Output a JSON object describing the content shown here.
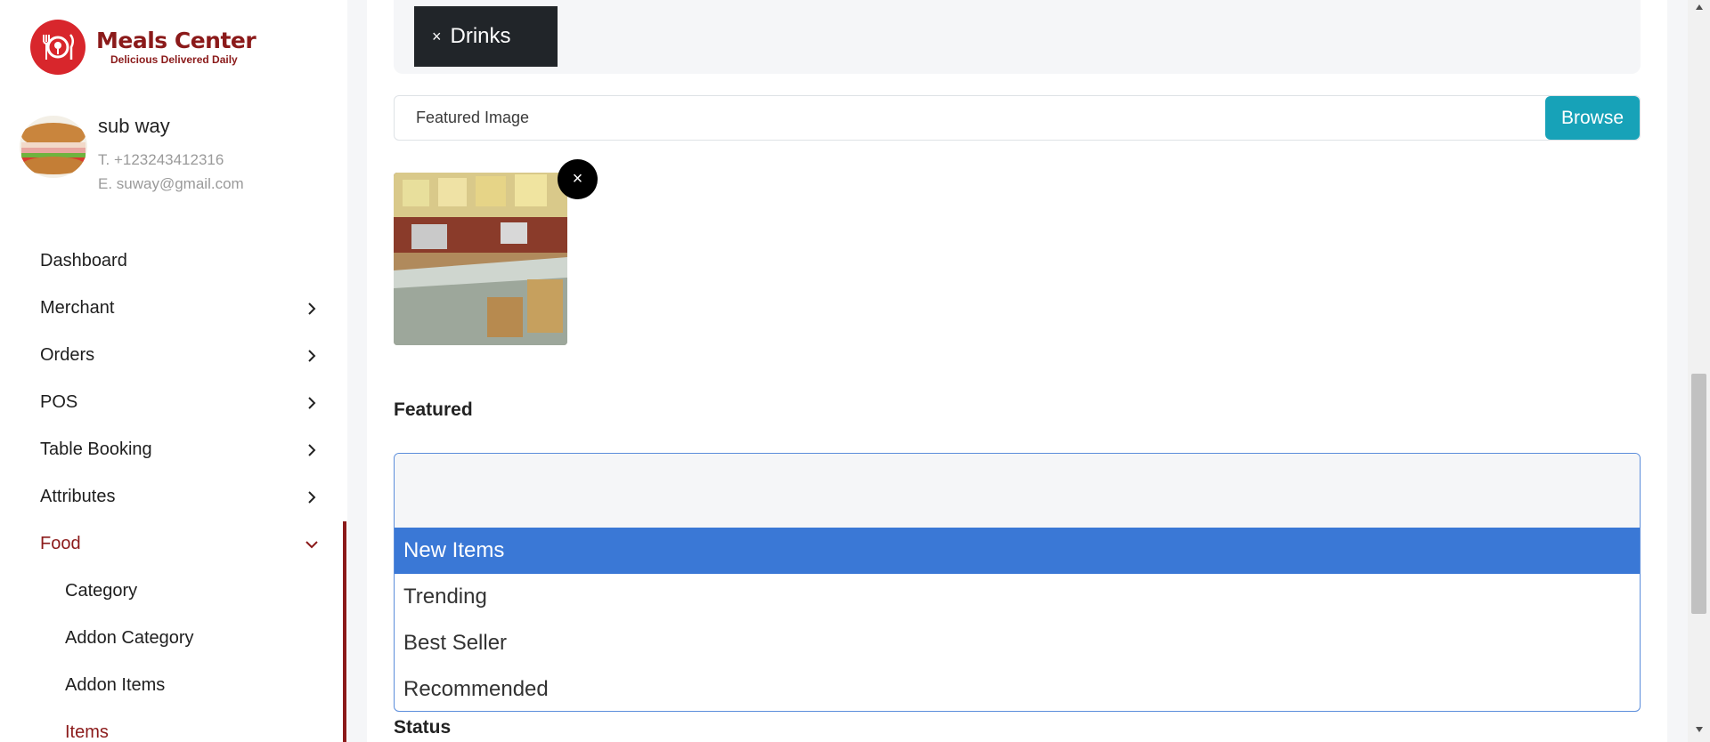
{
  "brand": {
    "title": "Meals Center",
    "tagline": "Delicious Delivered Daily",
    "color": "#8b1a1a",
    "logo_color": "#d8262c"
  },
  "profile": {
    "name": "sub way",
    "phone": "T. +123243412316",
    "email": "E. suway@gmail.com"
  },
  "sidebar": {
    "items": [
      {
        "label": "Dashboard"
      },
      {
        "label": "Merchant",
        "icon": "chevron-right-icon"
      },
      {
        "label": "Orders",
        "icon": "chevron-right-icon"
      },
      {
        "label": "POS",
        "icon": "chevron-right-icon"
      },
      {
        "label": "Table Booking",
        "icon": "chevron-right-icon"
      },
      {
        "label": "Attributes",
        "icon": "chevron-right-icon"
      },
      {
        "label": "Food",
        "icon": "chevron-down-icon",
        "active": true
      }
    ],
    "food_sub": [
      {
        "label": "Category"
      },
      {
        "label": "Addon Category"
      },
      {
        "label": "Addon Items"
      },
      {
        "label": "Items",
        "active": true
      }
    ]
  },
  "form": {
    "tag_remove": "×",
    "tag_label": "Drinks",
    "file_placeholder": "Featured Image",
    "browse_label": "Browse",
    "image_remove": "×",
    "featured_label": "Featured",
    "featured_options": [
      "New Items",
      "Trending",
      "Best Seller",
      "Recommended"
    ],
    "featured_selected": "New Items",
    "status_label": "Status"
  },
  "colors": {
    "browse": "#17a2b8",
    "selected_option": "#3a78d6",
    "tag_bg": "#212529"
  }
}
